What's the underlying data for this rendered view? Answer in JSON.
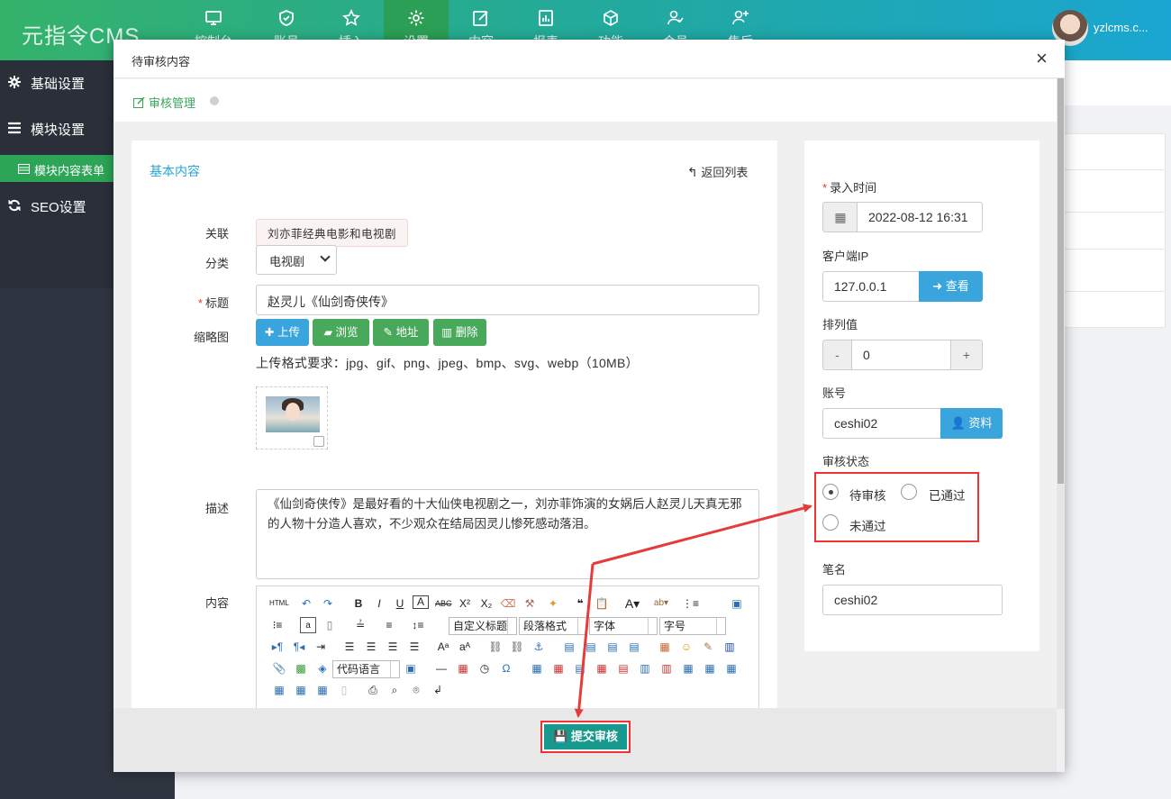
{
  "app": {
    "logo": "元指令CMS",
    "user": "yzlcms.c..."
  },
  "nav": [
    {
      "label": "控制台",
      "icon": "monitor-icon"
    },
    {
      "label": "账号",
      "icon": "shield-icon"
    },
    {
      "label": "插入",
      "icon": "star-icon"
    },
    {
      "label": "设置",
      "icon": "gear-icon",
      "active": true
    },
    {
      "label": "内容",
      "icon": "edit-icon"
    },
    {
      "label": "报表",
      "icon": "report-icon"
    },
    {
      "label": "功能",
      "icon": "cube-icon"
    },
    {
      "label": "会员",
      "icon": "user-check-icon"
    },
    {
      "label": "售后",
      "icon": "user-plus-icon"
    }
  ],
  "sidebar": {
    "items": [
      {
        "label": "基础设置",
        "icon": "gear-icon"
      },
      {
        "label": "模块设置",
        "icon": "list-icon"
      },
      {
        "label": "SEO设置",
        "icon": "refresh-icon"
      }
    ],
    "sub": {
      "label": "模块内容表单",
      "icon": "table-icon"
    }
  },
  "modal": {
    "title": "待审核内容",
    "close": "×"
  },
  "breadcrumb": {
    "label": "审核管理"
  },
  "form": {
    "section_title": "基本内容",
    "back": "返回列表",
    "labels": {
      "relation": "关联",
      "category": "分类",
      "title": "标题",
      "thumbnail": "缩略图",
      "description": "描述",
      "content": "内容"
    },
    "relation_tag": "刘亦菲经典电影和电视剧",
    "category_value": "电视剧",
    "title_value": "赵灵儿《仙剑奇侠传》",
    "buttons": {
      "upload": "上传",
      "browse": "浏览",
      "address": "地址",
      "delete": "删除"
    },
    "format_hint": "上传格式要求：jpg、gif、png、jpeg、bmp、svg、webp（10MB）",
    "description_value": "《仙剑奇侠传》是最好看的十大仙侠电视剧之一，刘亦菲饰演的女娲后人赵灵儿天真无邪的人物十分造人喜欢，不少观众在结局因灵儿惨死感动落泪。",
    "editor": {
      "custom_title": "自定义标题",
      "paragraph": "段落格式",
      "font": "字体",
      "font_size": "字号",
      "code_lang": "代码语言"
    }
  },
  "right": {
    "entry_time_label": "录入时间",
    "entry_time": "2022-08-12 16:31",
    "ip_label": "客户端IP",
    "ip": "127.0.0.1",
    "view": "查看",
    "sort_label": "排列值",
    "sort_value": "0",
    "minus": "-",
    "plus": "+",
    "account_label": "账号",
    "account": "ceshi02",
    "profile": "资料",
    "status_label": "审核状态",
    "status_options": [
      "待审核",
      "已通过",
      "未通过"
    ],
    "status_selected": "待审核",
    "pen_label": "笔名",
    "pen_name": "ceshi02"
  },
  "footer": {
    "submit": "提交审核"
  },
  "colors": {
    "accent_green": "#34b26a",
    "link_blue": "#27a4d8",
    "submit_teal": "#17998e",
    "highlight_red": "#e33333"
  }
}
